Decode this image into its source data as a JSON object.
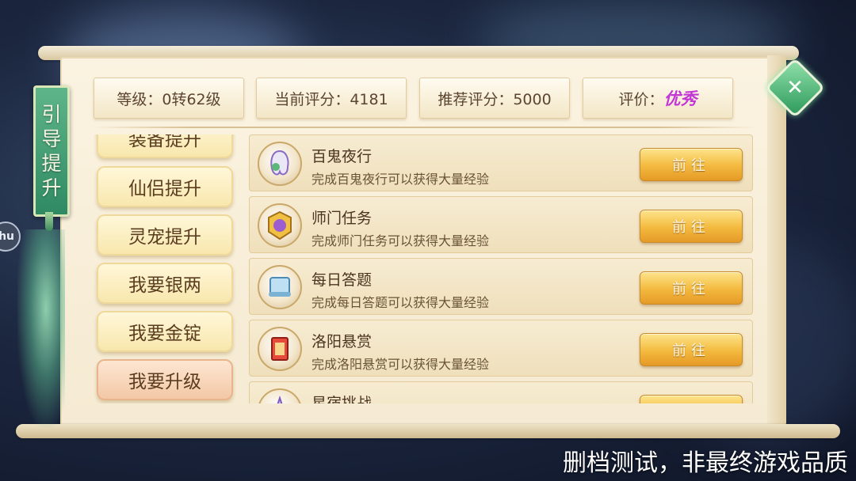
{
  "banner": {
    "chars": [
      "引",
      "导",
      "提",
      "升"
    ]
  },
  "side_badge": "hu",
  "stats": {
    "level": "等级：0转62级",
    "current_score": "当前评分：4181",
    "recommended_score": "推荐评分：5000",
    "rating_label": "评价：",
    "rating_value": "优秀"
  },
  "tabs": [
    {
      "label": "装备提升"
    },
    {
      "label": "仙侣提升"
    },
    {
      "label": "灵宠提升"
    },
    {
      "label": "我要银两"
    },
    {
      "label": "我要金锭"
    },
    {
      "label": "我要升级",
      "active": true
    }
  ],
  "tasks": [
    {
      "title": "百鬼夜行",
      "desc": "完成百鬼夜行可以获得大量经验",
      "button": "前往",
      "icon": "ghost-parade-icon"
    },
    {
      "title": "师门任务",
      "desc": "完成师门任务可以获得大量经验",
      "button": "前往",
      "icon": "sect-token-icon"
    },
    {
      "title": "每日答题",
      "desc": "完成每日答题可以获得大量经验",
      "button": "前往",
      "icon": "scroll-icon"
    },
    {
      "title": "洛阳悬赏",
      "desc": "完成洛阳悬赏可以获得大量经验",
      "button": "前往",
      "icon": "bounty-icon"
    },
    {
      "title": "星宿挑战",
      "desc": "",
      "button": "",
      "icon": "star-challenge-icon"
    }
  ],
  "watermark": "删档测试，非最终游戏品质",
  "colors": {
    "rating": "#c236d6",
    "go_button": "#f3b93e",
    "banner": "#2f8a63"
  }
}
